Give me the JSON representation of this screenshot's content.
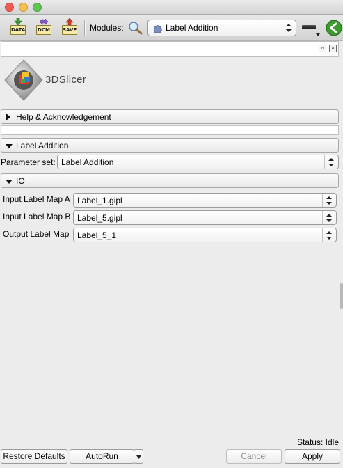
{
  "toolbar": {
    "buttons": [
      {
        "label": "DATA",
        "icon": "load-data-icon"
      },
      {
        "label": "DCM",
        "icon": "dicom-icon"
      },
      {
        "label": "SAVE",
        "icon": "save-icon"
      }
    ],
    "modules_label": "Modules:",
    "module_selected": "Label Addition"
  },
  "logo": {
    "text": "3DSlicer"
  },
  "sections": {
    "help": "Help & Acknowledgement",
    "module": "Label Addition",
    "io": "IO"
  },
  "parameter_set": {
    "label": "Parameter set:",
    "value": "Label Addition"
  },
  "io": {
    "rows": [
      {
        "label": "Input Label Map A",
        "value": "Label_1.gipl"
      },
      {
        "label": "Input Label Map B",
        "value": "Label_5.gipl"
      },
      {
        "label": "Output Label Map",
        "value": "Label_5_1"
      }
    ]
  },
  "status": "Status: Idle",
  "footer": {
    "restore": "Restore Defaults",
    "autorun": "AutoRun",
    "cancel": "Cancel",
    "apply": "Apply"
  },
  "colors": {
    "close": "#ee5d55",
    "minimize": "#f5be4f",
    "zoom": "#5fc453",
    "accent": "#3d9a2f"
  }
}
